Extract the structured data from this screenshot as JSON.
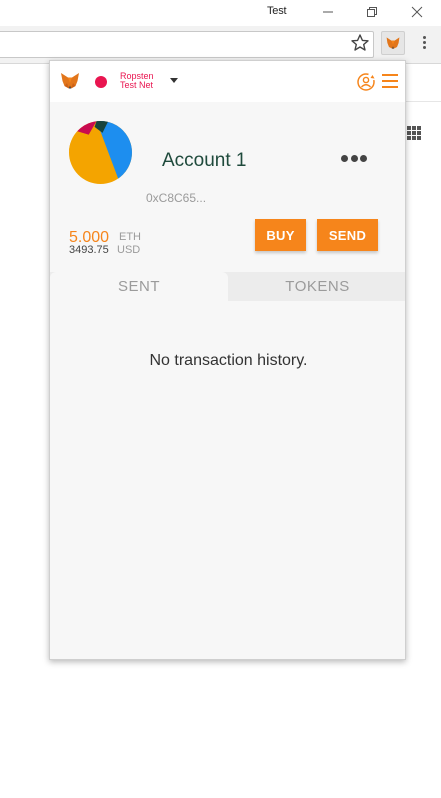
{
  "window": {
    "title": "Test"
  },
  "network": {
    "name_line1": "Ropsten",
    "name_line2": "Test Net"
  },
  "account": {
    "name": "Account 1",
    "address": "0xC8C65..."
  },
  "balance": {
    "eth_value": "5.000",
    "eth_unit": "ETH",
    "usd_value": "3493.75",
    "usd_unit": "USD"
  },
  "actions": {
    "buy_label": "BUY",
    "send_label": "SEND"
  },
  "tabs": [
    {
      "label": "SENT"
    },
    {
      "label": "TOKENS"
    }
  ],
  "history": {
    "empty_message": "No transaction history."
  },
  "icons": {
    "brand_logo": "metamask-fox-icon",
    "menu": "hamburger-menu-icon",
    "account_switch": "account-switch-icon",
    "more": "more-options-icon",
    "bookmark": "star-icon"
  },
  "colors": {
    "accent": "#f6851b",
    "network_dot": "#e91550",
    "account_name": "#1f4a3c"
  }
}
